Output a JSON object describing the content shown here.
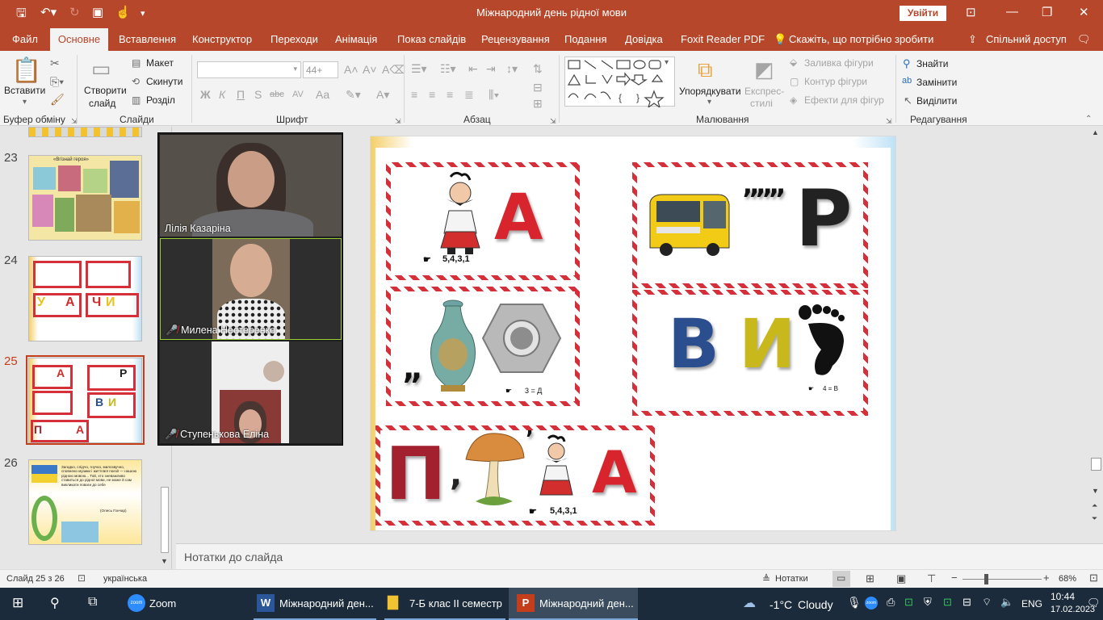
{
  "titlebar": {
    "title": "Міжнародний день рідної мови",
    "signin": "Увійти"
  },
  "tabs": [
    "Файл",
    "Основне",
    "Вставлення",
    "Конструктор",
    "Переходи",
    "Анімація",
    "Показ слайдів",
    "Рецензування",
    "Подання",
    "Довідка",
    "Foxit Reader PDF",
    "Скажіть, що потрібно зробити",
    "Спільний доступ"
  ],
  "ribbon": {
    "paste": "Вставити",
    "new_slide_1": "Створити",
    "new_slide_2": "слайд",
    "layout": "Макет",
    "reset": "Скинути",
    "section": "Розділ",
    "font_size": "44+",
    "font_btns": [
      "Ж",
      "К",
      "П",
      "S",
      "abc",
      "AV",
      "Aa"
    ],
    "arrange": "Упорядкувати",
    "quick_styles_1": "Експрес-",
    "quick_styles_2": "стилі",
    "shape_fill": "Заливка фігури",
    "shape_outline": "Контур фігури",
    "shape_effects": "Ефекти для фігур",
    "find": "Знайти",
    "replace": "Замінити",
    "select": "Виділити",
    "groups": {
      "clipboard": "Буфер обміну",
      "slides": "Слайди",
      "font": "Шрифт",
      "paragraph": "Абзац",
      "drawing": "Малювання",
      "editing": "Редагування"
    }
  },
  "thumbs": {
    "n23": "23",
    "n24": "24",
    "n25": "25",
    "n26": "26",
    "t23_title": "«Вгізнай героя»",
    "t26_text": "Загадко, слідчо, гнучко, милозвучно, сповнено музики і життєвої поезії — нашою рідною мовою... Той, хто зневажливо ставиться до рідної мови, не може й сам викликати поваги до себе",
    "t26_author": "(Олесь Гончар)"
  },
  "zoom": {
    "p1": "Лілія Казаріна",
    "p2": "Милена Нестеренко",
    "p3": "Ступенькова Еліна"
  },
  "slide": {
    "card1": {
      "letter": "А",
      "hint": "5,4,3,1"
    },
    "card2": {
      "quotes": "„„„",
      "letter": "Р"
    },
    "card3": {
      "comma": "„",
      "hint": "3 = Д"
    },
    "card4": {
      "letter1": "В",
      "letter2": "И",
      "hint": "4 = В"
    },
    "card5": {
      "letter1": "П",
      "comma": ",",
      "letter2": "А",
      "hint": "5,4,3,1"
    }
  },
  "notes": "Нотатки до слайда",
  "status": {
    "slide": "Слайд 25 з 26",
    "lang": "українська",
    "notes_btn": "Нотатки",
    "zoom": "68%"
  },
  "taskbar": {
    "zoom_app": "Zoom",
    "word": "Міжнародний ден...",
    "folder": "7-Б клас ІІ семестр",
    "ppt": "Міжнародний ден...",
    "weather_temp": "-1°C",
    "weather_desc": "Cloudy",
    "lang": "ENG",
    "time": "10:44",
    "date": "17.02.2023"
  },
  "colors": {
    "accent": "#b7472a",
    "taskbar": "#1b2b3b",
    "candy": "#d5303a"
  }
}
